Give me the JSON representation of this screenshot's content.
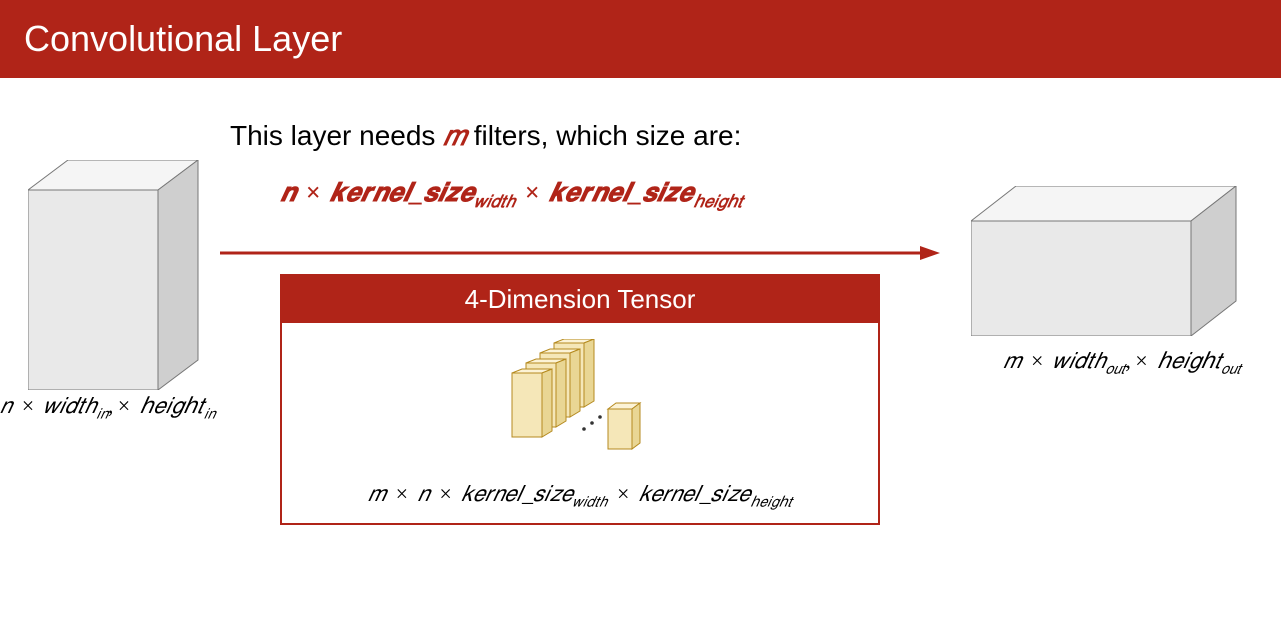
{
  "title": "Convolutional Layer",
  "caption_before_m": "This layer needs ",
  "caption_m": "𝑚",
  "caption_after_m": " filters, which size are:",
  "filter_formula_html": "𝒏 <span class='times'>×</span> 𝒌𝒆𝒓𝒏𝒆𝒍_𝒔𝒊𝒛𝒆<sub>𝑤𝑖𝑑𝑡ℎ</sub> <span class='times'>×</span> 𝒌𝒆𝒓𝒏𝒆𝒍_𝒔𝒊𝒛𝒆<sub>ℎ𝑒𝑖𝑔ℎ𝑡</sub>",
  "input_size_html": "𝑛 <span class='times'>×</span> 𝑤𝑖𝑑𝑡ℎ<sub>𝑖𝑛</sub>,<span class='times'>×</span> ℎ𝑒𝑖𝑔ℎ𝑡<sub>𝑖𝑛</sub>",
  "output_size_html": "𝑚 <span class='times'>×</span> 𝑤𝑖𝑑𝑡ℎ<sub>𝑜𝑢𝑡</sub>,<span class='times'>×</span> ℎ𝑒𝑖𝑔ℎ𝑡<sub>𝑜𝑢𝑡</sub>",
  "tensor_title": "4-Dimension Tensor",
  "tensor_formula_html": "𝑚 <span class='times'>×</span> 𝑛 <span class='times'>×</span> 𝑘𝑒𝑟𝑛𝑒𝑙_𝑠𝑖𝑧𝑒<sub>𝑤𝑖𝑑𝑡ℎ</sub> <span class='times'>×</span> 𝑘𝑒𝑟𝑛𝑒𝑙_𝑠𝑖𝑧𝑒<sub>ℎ𝑒𝑖𝑔ℎ𝑡</sub>",
  "colors": {
    "brand": "#b02418",
    "box_fill": "#e9e9e9",
    "box_fill_light": "#f5f5f5",
    "filter_fill": "#f5e7b8",
    "filter_stroke": "#b58a1f"
  }
}
